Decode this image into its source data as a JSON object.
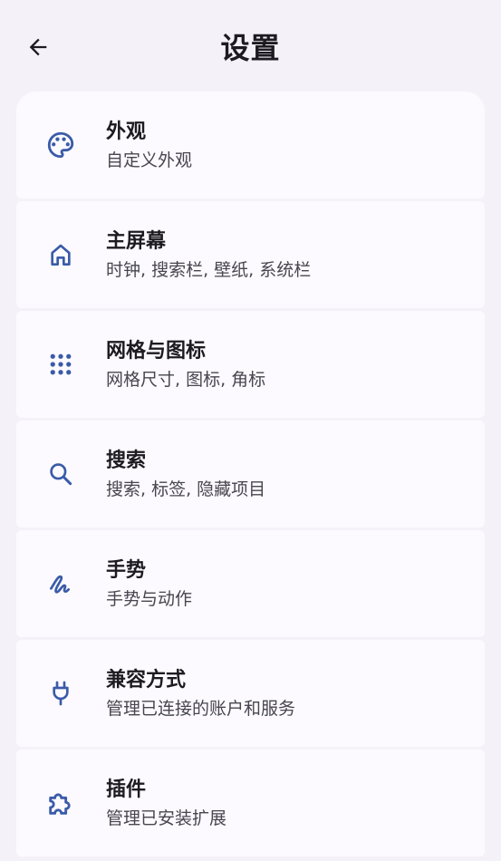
{
  "header": {
    "title": "设置"
  },
  "colors": {
    "background": "#f4f2f8",
    "card": "#fcfafe",
    "icon": "#3a5ba8",
    "text": "#1d1b20",
    "subtext": "#47464f"
  },
  "items": [
    {
      "icon": "palette-icon",
      "label": "外观",
      "sub": "自定义外观"
    },
    {
      "icon": "home-icon",
      "label": "主屏幕",
      "sub": "时钟, 搜索栏, 壁纸, 系统栏"
    },
    {
      "icon": "grid-icon",
      "label": "网格与图标",
      "sub": "网格尺寸, 图标, 角标"
    },
    {
      "icon": "search-icon",
      "label": "搜索",
      "sub": "搜索, 标签, 隐藏项目"
    },
    {
      "icon": "gesture-icon",
      "label": "手势",
      "sub": "手势与动作"
    },
    {
      "icon": "plug-icon",
      "label": "兼容方式",
      "sub": "管理已连接的账户和服务"
    },
    {
      "icon": "puzzle-icon",
      "label": "插件",
      "sub": "管理已安装扩展"
    }
  ]
}
